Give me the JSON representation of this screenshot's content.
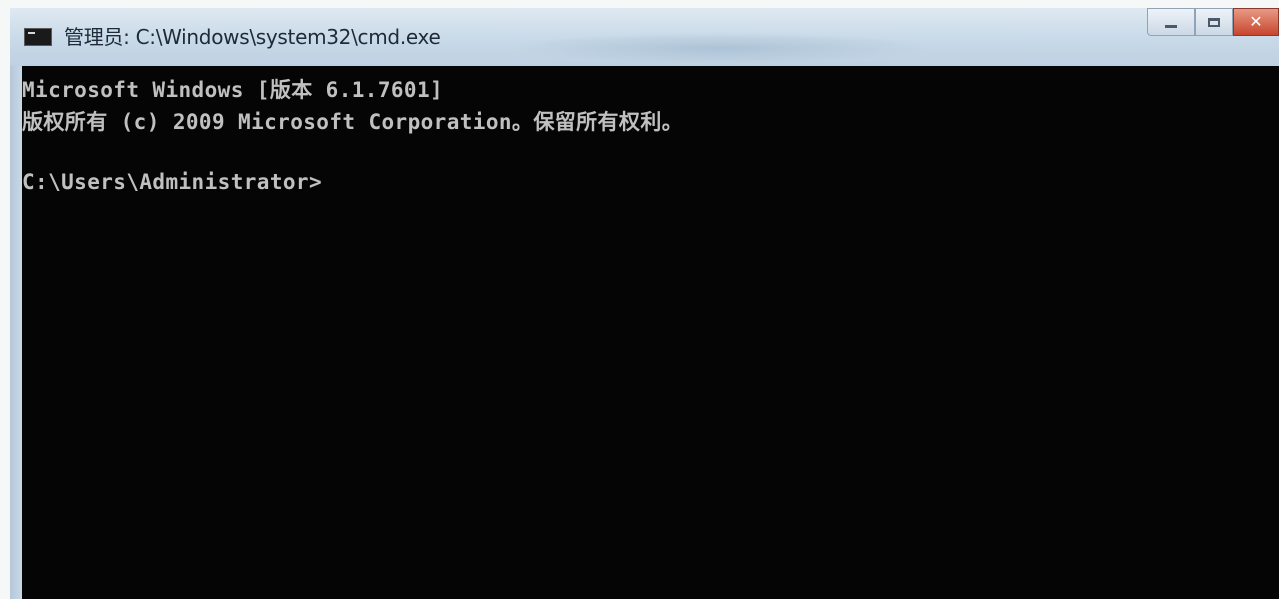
{
  "window": {
    "title": "管理员: C:\\Windows\\system32\\cmd.exe",
    "icon": "cmd-console-icon",
    "controls": {
      "minimize_icon": "minimize-icon",
      "maximize_icon": "maximize-icon",
      "close_icon": "close-icon",
      "close_label": "✕"
    }
  },
  "console": {
    "lines": [
      "Microsoft Windows [版本 6.1.7601]",
      "版权所有 (c) 2009 Microsoft Corporation。保留所有权利。"
    ],
    "prompt": "C:\\Users\\Administrator>"
  },
  "colors": {
    "console_background": "#050505",
    "console_text": "#c0c0c0",
    "titlebar": "#c8d9e8",
    "close_button": "#c8452c"
  }
}
